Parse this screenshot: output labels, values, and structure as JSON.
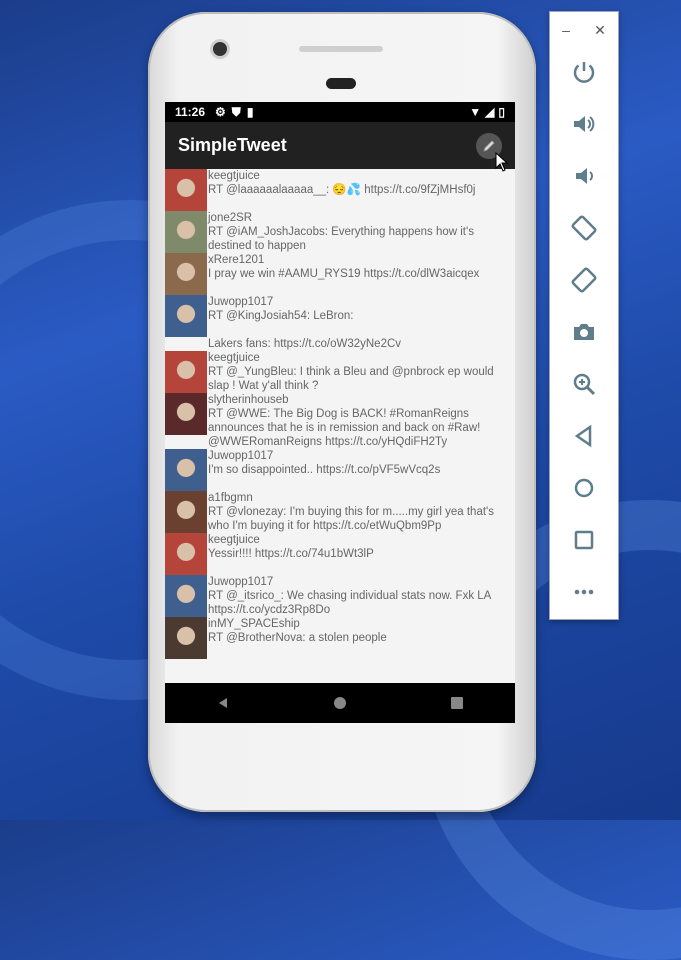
{
  "status_bar": {
    "time": "11:26"
  },
  "app_bar": {
    "title": "SimpleTweet"
  },
  "tweets": [
    {
      "handle": "keegtjuice",
      "text": "RT @laaaaaalaaaaa__: 😔💦 https://t.co/9fZjMHsf0j",
      "avatar_color": "#b5443a"
    },
    {
      "handle": "jone2SR",
      "text": "RT @iAM_JoshJacobs: Everything happens how it's destined to happen",
      "avatar_color": "#7f8a6a"
    },
    {
      "handle": "xRere1201",
      "text": "I pray we win #AAMU_RYS19 https://t.co/dlW3aicqex",
      "avatar_color": "#8a6a4a"
    },
    {
      "handle": "Juwopp1017",
      "text": "RT @KingJosiah54: LeBron:",
      "avatar_color": "#3f5f8f"
    },
    {
      "handle": "",
      "text": "Lakers fans: https://t.co/oW32yNe2Cv",
      "avatar_color": ""
    },
    {
      "handle": "keegtjuice",
      "text": "RT @_YungBleu: I think a Bleu and @pnbrock ep would slap ! Wat y'all think ?",
      "avatar_color": "#b5443a"
    },
    {
      "handle": "slytherinhouseb",
      "text": "RT @WWE: The Big Dog is BACK! #RomanReigns announces that he is in remission and back on #Raw! @WWERomanReigns https://t.co/yHQdiFH2Ty",
      "avatar_color": "#5a2a2a"
    },
    {
      "handle": "Juwopp1017",
      "text": "I'm so disappointed.. https://t.co/pVF5wVcq2s",
      "avatar_color": "#3f5f8f"
    },
    {
      "handle": "a1fbgmn",
      "text": "RT @vlonezay: I'm buying this for m.....my girl yea that's who I'm buying it for https://t.co/etWuQbm9Pp",
      "avatar_color": "#6a4030"
    },
    {
      "handle": "keegtjuice",
      "text": "Yessir!!!! https://t.co/74u1bWt3lP",
      "avatar_color": "#b5443a"
    },
    {
      "handle": "Juwopp1017",
      "text": "RT @_itsrico_: We chasing individual stats now. Fxk LA https://t.co/ycdz3Rp8Do",
      "avatar_color": "#3f5f8f"
    },
    {
      "handle": "inMY_SPACEship",
      "text": "RT @BrotherNova: a stolen people",
      "avatar_color": "#4a3a30"
    }
  ],
  "emulator": {
    "minimize_label": "–",
    "close_label": "✕",
    "controls": [
      "power-icon",
      "volume-up-icon",
      "volume-down-icon",
      "rotate-left-icon",
      "rotate-right-icon",
      "screenshot-icon",
      "zoom-icon",
      "back-icon",
      "home-icon",
      "overview-icon",
      "more-icon"
    ]
  }
}
